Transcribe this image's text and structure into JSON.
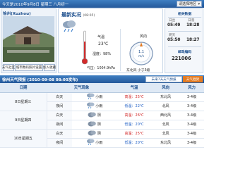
{
  "topbar": {
    "date": "今天是2010年9月8日 星期三 八月初一",
    "region_label": "请选择地区"
  },
  "city": {
    "title": "徐州(Xuzhou)",
    "buttons": [
      "天气社区",
      "城市数码照片设置",
      "加入收藏"
    ]
  },
  "current": {
    "title": "最新实况",
    "time": "(08:05)",
    "weather_icon": "rain-cloud-icon",
    "temp_label": "气温",
    "temp": "23℃",
    "humidity": "湿度：98%",
    "pressure": "气压：1004.9hPa",
    "wind_dir_label": "风向",
    "wind_speed": "1.1",
    "wind_unit": "m/s",
    "wind": "东北风 小于3级"
  },
  "info": {
    "sunrise_title": "相关数据",
    "sunrise_caption": "日出",
    "sunrise": "05:49",
    "sunset_caption": "日落",
    "sunset": "18:28",
    "tomorrow_caption": "明天",
    "tomorrow_sunrise": "05:50",
    "tomorrow_sunset": "18:27",
    "zip_label": "邮政编码",
    "zip": "221006"
  },
  "forecast": {
    "title": "徐州天气预报 (2010-09-08 08:00发布)",
    "tab_future": "未来7天天气预报",
    "tab_trend": "天气趋势",
    "headers": [
      "日期",
      "天气现象",
      "气温",
      "风向",
      "风力"
    ],
    "days": [
      {
        "date": "8日星期三",
        "rows": [
          {
            "period": "白天",
            "icon": "rain-icon",
            "weather": "小雨",
            "temp": "高温：25℃",
            "temp_kind": "hot",
            "wind_dir": "东北风",
            "wind_force": "3-4级"
          },
          {
            "period": "夜间",
            "icon": "rain-icon",
            "weather": "小雨",
            "temp": "低温：22℃",
            "temp_kind": "cold",
            "wind_dir": "北风",
            "wind_force": "3-4级"
          }
        ]
      },
      {
        "date": "9日星期四",
        "rows": [
          {
            "period": "白天",
            "icon": "cloudy-icon",
            "weather": "阴",
            "temp": "高温：26℃",
            "temp_kind": "hot",
            "wind_dir": "西北风",
            "wind_force": "3-4级"
          },
          {
            "period": "夜间",
            "icon": "cloudy-icon",
            "weather": "阴",
            "temp": "低温：20℃",
            "temp_kind": "cold",
            "wind_dir": "北风",
            "wind_force": "3-4级"
          }
        ]
      },
      {
        "date": "10日星期五",
        "rows": [
          {
            "period": "白天",
            "icon": "cloudy-icon",
            "weather": "阴",
            "temp": "高温：25℃",
            "temp_kind": "hot",
            "wind_dir": "北风",
            "wind_force": "3-4级"
          },
          {
            "period": "夜间",
            "icon": "rain-icon",
            "weather": "小雨",
            "temp": "低温：20℃",
            "temp_kind": "cold",
            "wind_dir": "东北风",
            "wind_force": "3-4级"
          }
        ]
      }
    ]
  }
}
